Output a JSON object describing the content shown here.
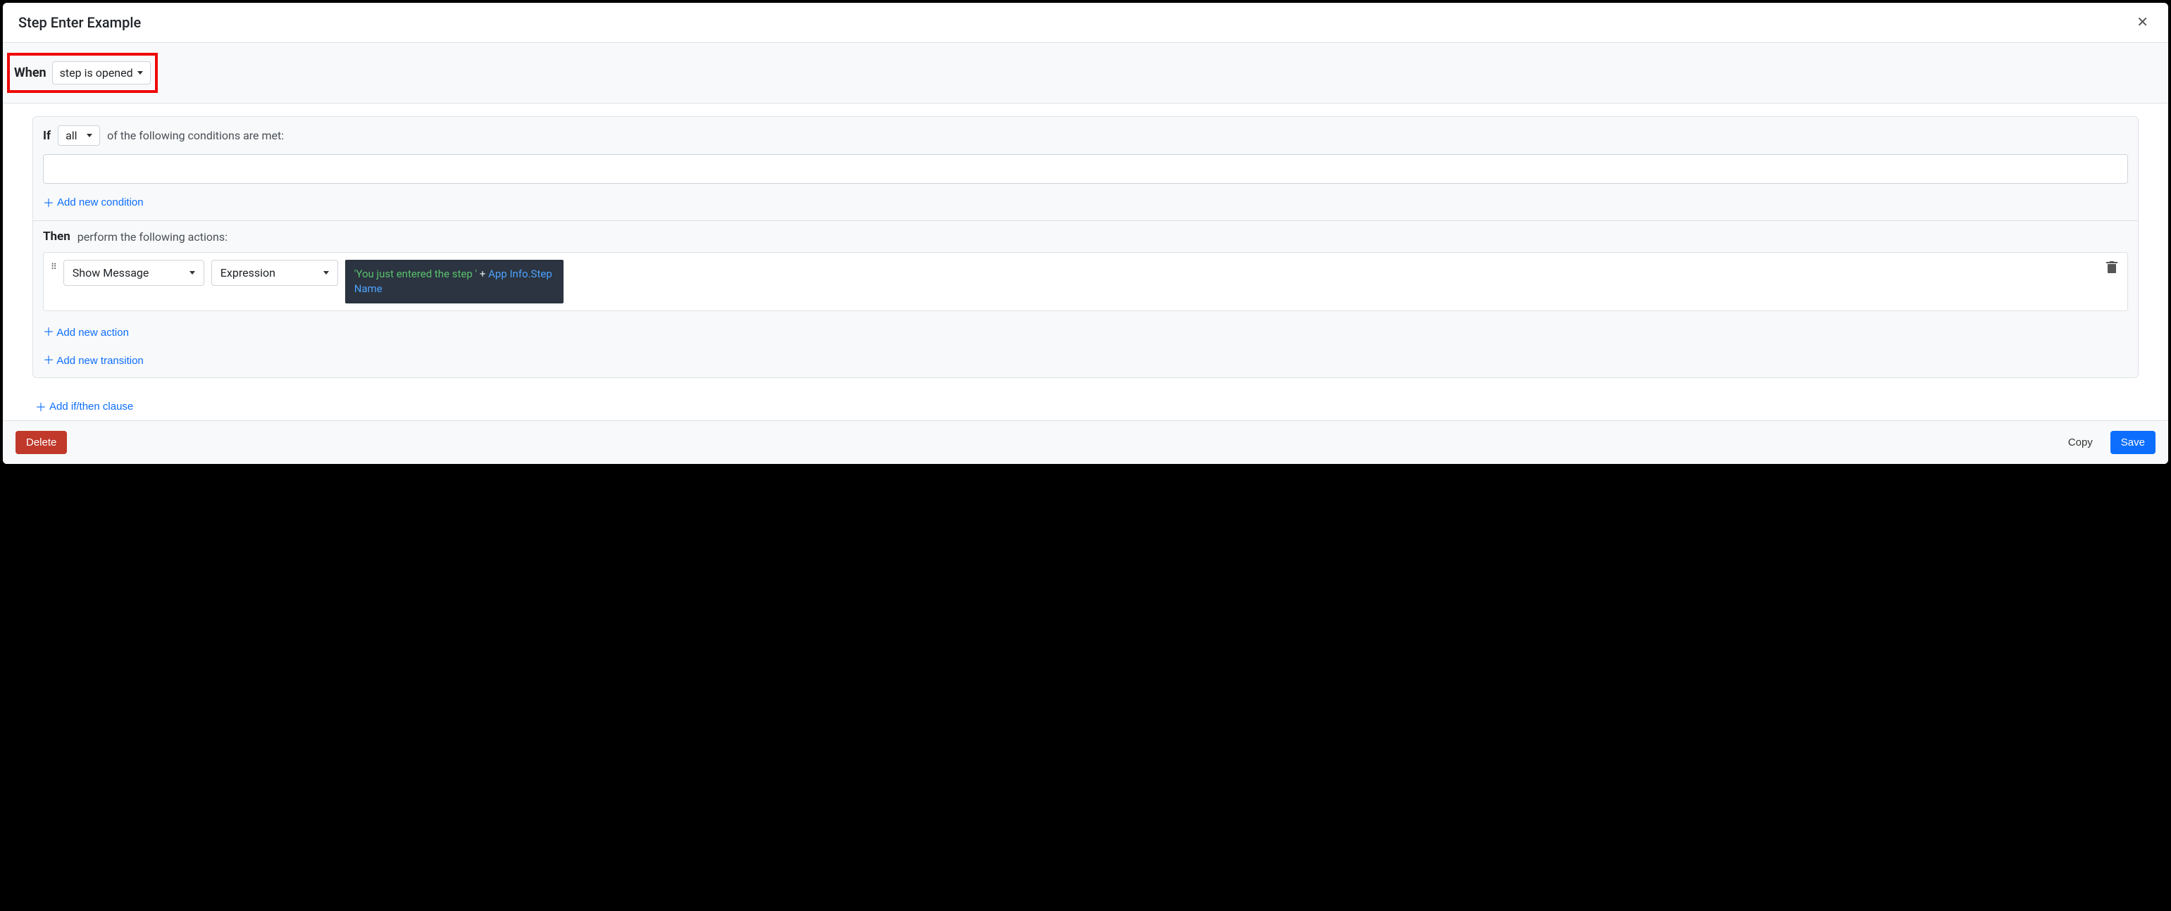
{
  "header": {
    "title": "Step Enter Example"
  },
  "when": {
    "label": "When",
    "trigger": "step is opened"
  },
  "ifClause": {
    "keyword": "If",
    "quantifier": "all",
    "suffix": "of the following conditions are met:",
    "addCondition": "Add new condition"
  },
  "thenClause": {
    "keyword": "Then",
    "suffix": "perform the following actions:",
    "action": {
      "type": "Show Message",
      "mode": "Expression",
      "exprString": "'You just entered the step '",
      "exprOp": "+",
      "exprVar": "App Info.Step Name"
    },
    "addAction": "Add new action",
    "addTransition": "Add new transition"
  },
  "addClause": "Add if/then clause",
  "footer": {
    "delete": "Delete",
    "copy": "Copy",
    "save": "Save"
  }
}
